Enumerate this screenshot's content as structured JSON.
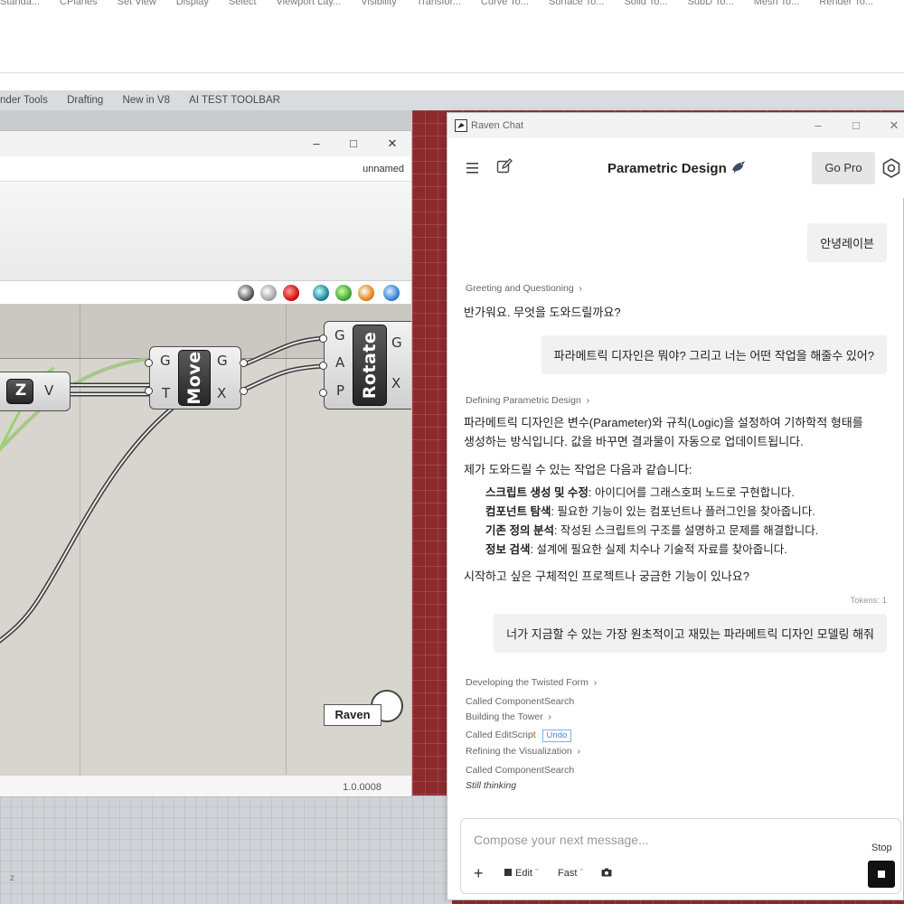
{
  "rhino": {
    "top_tabs": [
      "Standa...",
      "CPlanes",
      "Set View",
      "Display",
      "Select",
      "Viewport Lay...",
      "Visibility",
      "Transfor...",
      "Curve To...",
      "Surface To...",
      "Solid To...",
      "SubD To...",
      "Mesh To...",
      "Render To..."
    ],
    "second_tabs": [
      "nder Tools",
      "Drafting",
      "New in V8",
      "AI TEST TOOLBAR"
    ],
    "axis_label": "z"
  },
  "grasshopper": {
    "doc_name": "unnamed",
    "version": "1.0.0008",
    "raven_badge": "Raven",
    "components": {
      "z_node": {
        "label": "Z",
        "out": "V"
      },
      "move": {
        "label": "Move",
        "in": [
          "G",
          "T"
        ],
        "out": [
          "G",
          "X"
        ]
      },
      "rotate": {
        "label": "Rotate",
        "in": [
          "G",
          "A",
          "P"
        ],
        "out": [
          "G",
          "X"
        ]
      }
    }
  },
  "chat": {
    "window_title": "Raven Chat",
    "heading": "Parametric Design",
    "go_pro": "Go Pro",
    "messages": {
      "user1": "안녕레이븐",
      "step1": "Greeting and Questioning",
      "reply1": "반가워요. 무엇을 도와드릴까요?",
      "user2": "파라메트릭 디자인은 뭐야? 그리고 너는 어떤 작업을 해줄수 있어?",
      "step2": "Defining Parametric Design",
      "reply2_p1_line1": "파라메트릭 디자인은 변수(Parameter)와 규칙(Logic)을 설정하여 기하학적 형태를",
      "reply2_p1_line2": "생성하는 방식입니다. 값을 바꾸면 결과물이 자동으로 업데이트됩니다.",
      "reply2_p2": "제가 도와드릴 수 있는 작업은 다음과 같습니다:",
      "bullets": [
        {
          "title": "스크립트 생성 및 수정",
          "text": ": 아이디어를 그래스호퍼 노드로 구현합니다."
        },
        {
          "title": "컴포넌트 탐색",
          "text": ": 필요한 기능이 있는 컴포넌트나 플러그인을 찾아줍니다."
        },
        {
          "title": "기존 정의 분석",
          "text": ": 작성된 스크립트의 구조를 설명하고 문제를 해결합니다."
        },
        {
          "title": "정보 검색",
          "text": ": 설계에 필요한 실제 치수나 기술적 자료를 찾아줍니다."
        }
      ],
      "reply2_p3": "시작하고 싶은 구체적인 프로젝트나 궁금한 기능이 있나요?",
      "tokens": "Tokens: 1",
      "user3": "너가 지금할 수 있는 가장 원초적이고 재밌는 파라메트릭 디자인 모델링 해줘",
      "activity": [
        "Developing the Twisted Form",
        "Called ComponentSearch",
        "Building the Tower",
        "Called EditScript",
        "Refining the Visualization",
        "Called ComponentSearch"
      ],
      "undo": "Undo",
      "thinking": "Still thinking"
    },
    "composer": {
      "placeholder": "Compose your next message...",
      "edit": "Edit",
      "fast": "Fast",
      "stop": "Stop"
    }
  }
}
